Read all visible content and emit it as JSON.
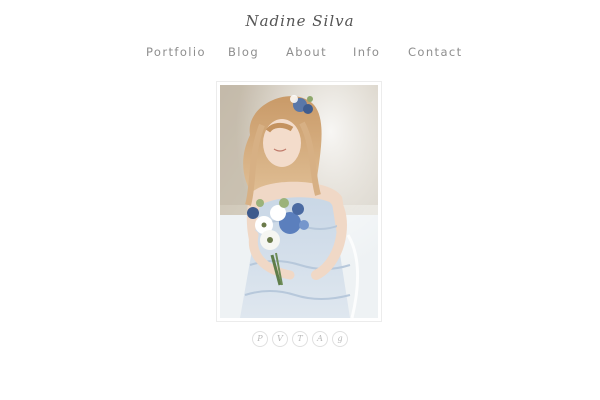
{
  "header": {
    "logo_text": "Nadine Silva"
  },
  "nav": {
    "items": [
      "Portfolio",
      "Blog",
      "About",
      "Info",
      "Contact"
    ]
  },
  "main": {
    "photo": {
      "subject": "bride holding blue and white bouquet"
    }
  },
  "footer": {
    "social_icons": [
      {
        "name": "pinterest-icon",
        "glyph": "P"
      },
      {
        "name": "vimeo-icon",
        "glyph": "V"
      },
      {
        "name": "tumblr-icon",
        "glyph": "T"
      },
      {
        "name": "instagram-icon",
        "glyph": "A"
      },
      {
        "name": "google-plus-icon",
        "glyph": "g"
      }
    ]
  },
  "colors": {
    "nav_text": "#8e8e8e",
    "logo_text": "#555555",
    "icon_border": "#e0e0e0",
    "background": "#ffffff"
  }
}
